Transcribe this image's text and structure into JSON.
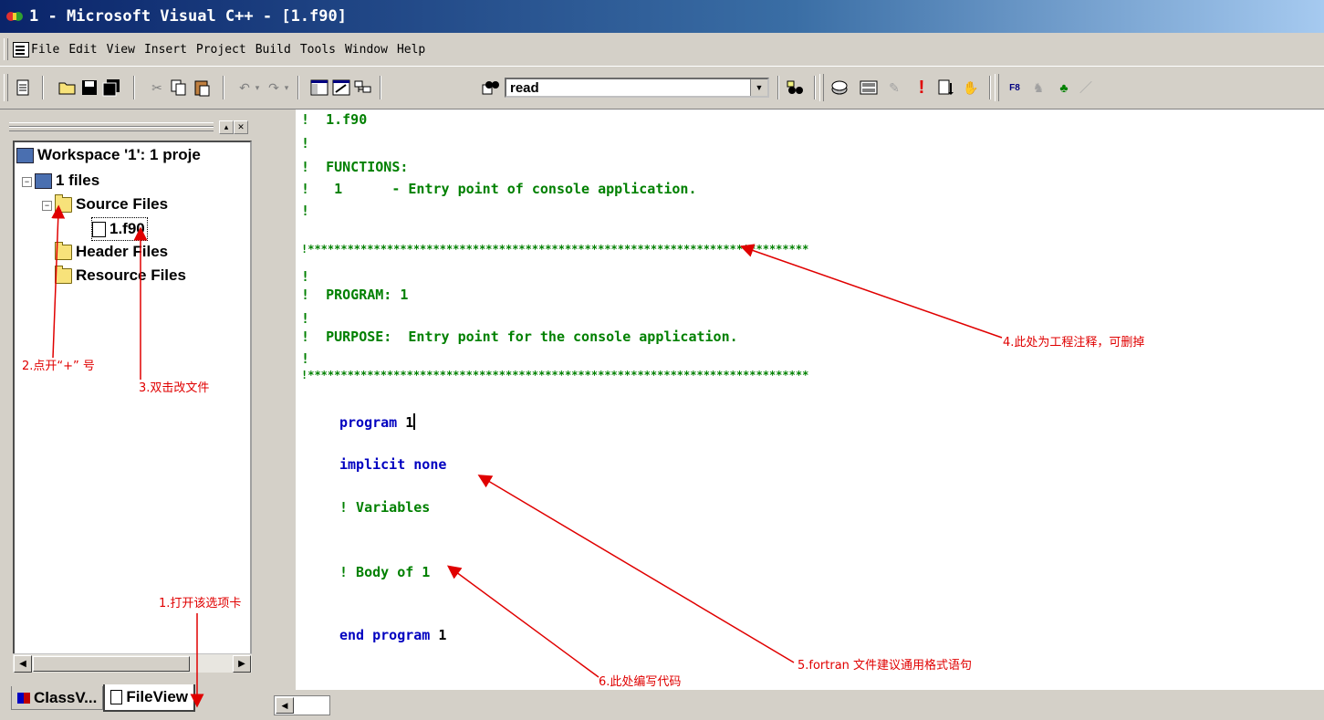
{
  "window": {
    "title": "1 - Microsoft Visual C++ - [1.f90]"
  },
  "menu": {
    "items": [
      "File",
      "Edit",
      "View",
      "Insert",
      "Project",
      "Build",
      "Tools",
      "Window",
      "Help"
    ]
  },
  "toolbar": {
    "find_combo_value": "read"
  },
  "workspace": {
    "tree": {
      "workspace_label": "Workspace '1': 1 proje",
      "project_label": "1 files",
      "source_folder": "Source Files",
      "source_file": "1.f90",
      "header_folder": "Header Files",
      "resource_folder": "Resource Files"
    },
    "tabs": {
      "classview": "ClassV...",
      "fileview": "FileView"
    }
  },
  "editor": {
    "lines": [
      "!  1.f90",
      "!",
      "!  FUNCTIONS:",
      "!   1      - Entry point of console application.",
      "!",
      "!****************************************************************************",
      "!",
      "!  PROGRAM: 1",
      "!",
      "!  PURPOSE:  Entry point for the console application.",
      "!",
      "!****************************************************************************"
    ],
    "code": {
      "program_kw": "program",
      "program_name": "1",
      "implicit": "implicit none",
      "variables_comment": "! Variables",
      "body_comment": "! Body of 1",
      "end_kw": "end program",
      "end_name": "1"
    }
  },
  "annotations": {
    "a1": "1.打开该选项卡",
    "a2": "2.点开“+” 号",
    "a3": "3.双击改文件",
    "a4": "4.此处为工程注释，可删掉",
    "a5": "5.fortran 文件建议通用格式语句",
    "a6": "6.此处编写代码"
  },
  "colors": {
    "comment": "#008000",
    "keyword": "#0000c0",
    "annotation": "#e00000",
    "titlebar": "#0a246a"
  }
}
